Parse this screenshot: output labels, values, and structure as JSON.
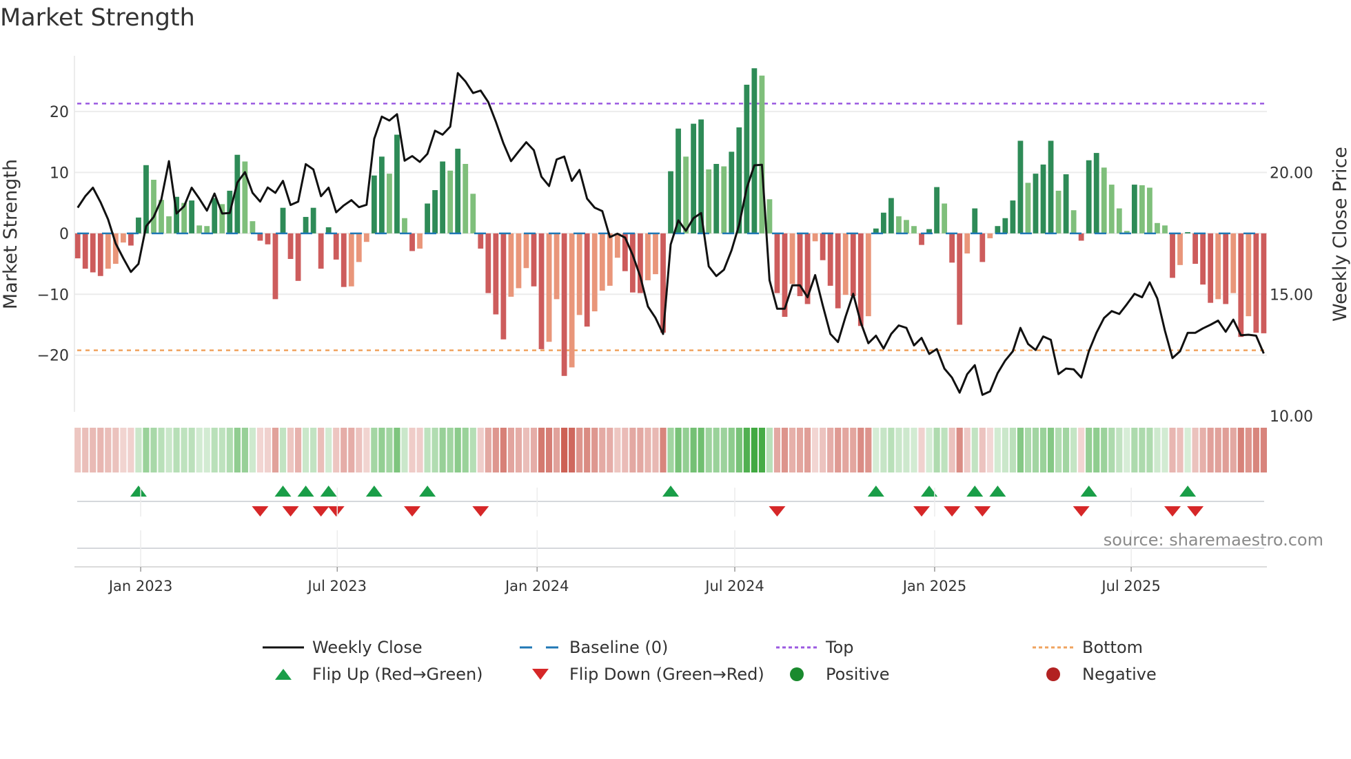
{
  "title": "Market Strength",
  "source": "source: sharemaestro.com",
  "legend": {
    "weekly_close": "Weekly Close",
    "baseline": "Baseline (0)",
    "top": "Top",
    "bottom": "Bottom",
    "flip_up": "Flip Up (Red→Green)",
    "flip_down": "Flip Down (Green→Red)",
    "positive": "Positive",
    "negative": "Negative"
  },
  "colors": {
    "pos_strong": "#2e8b57",
    "pos_weak": "#7fbf7b",
    "neg_strong": "#cd5c5c",
    "neg_weak": "#e9967a",
    "baseline": "#1f77b4",
    "top": "#9b59e0",
    "bottom": "#f0a35e",
    "price": "#111111",
    "flip_up": "#1a9e48",
    "flip_down": "#d62728",
    "positive": "#1a8a2e",
    "negative": "#b22222"
  },
  "chart_data": {
    "type": "bar",
    "title": "Market Strength",
    "ylabel": "Market Strength",
    "ylabel_right": "Weekly Close Price",
    "xlabel": "",
    "start_date": "2022-11-04",
    "frequency": "weekly",
    "ylim": [
      -29.3,
      29.15
    ],
    "ylim_right": [
      10.17,
      24.8
    ],
    "yticks_left": {
      "values": [
        -20,
        -10,
        0,
        10,
        20
      ],
      "labels": [
        "−20",
        "−10",
        "0",
        "10",
        "20"
      ]
    },
    "yticks_right": {
      "values": [
        10,
        15,
        20
      ],
      "labels": [
        "10.00",
        "15.00",
        "20.00"
      ]
    },
    "xticks": {
      "dates": [
        "2023-01-01",
        "2023-07-01",
        "2024-01-01",
        "2024-07-01",
        "2025-01-01",
        "2025-07-01"
      ],
      "labels": [
        "Jan 2023",
        "Jul 2023",
        "Jan 2024",
        "Jul 2024",
        "Jan 2025",
        "Jul 2025"
      ]
    },
    "top_level": 21.3,
    "bottom_level": -19.2,
    "baseline": 0,
    "strength": [
      -4.1,
      -5.8,
      -6.4,
      -7,
      -5.8,
      -5,
      -1.5,
      -2,
      2.6,
      11.2,
      8.8,
      5.5,
      2.8,
      6,
      5,
      5.4,
      1.3,
      1.2,
      5.8,
      4.8,
      7,
      12.9,
      11.8,
      2,
      -1.2,
      -1.8,
      -10.8,
      4.2,
      -4.2,
      -7.8,
      2.7,
      4.2,
      -5.8,
      1,
      -4.3,
      -8.8,
      -8.7,
      -4.7,
      -1.4,
      9.5,
      12.6,
      9.8,
      16.2,
      2.5,
      -2.9,
      -2.5,
      4.9,
      7.1,
      11.8,
      10.3,
      13.9,
      11.4,
      6.5,
      -2.5,
      -9.8,
      -13.3,
      -17.4,
      -10.4,
      -9,
      -5.7,
      -8.7,
      -19,
      -17.8,
      -10.8,
      -23.4,
      -22,
      -13.4,
      -15.3,
      -12.8,
      -9.4,
      -8.6,
      -4,
      -6.2,
      -9.7,
      -9.8,
      -7.7,
      -6.7,
      -16.3,
      10.2,
      17.2,
      12.6,
      18,
      18.7,
      10.5,
      11.4,
      11,
      13.4,
      17.4,
      24.4,
      27.1,
      25.9,
      5.6,
      -9.8,
      -13.7,
      -8.3,
      -10.3,
      -11.6,
      -1.3,
      -4.4,
      -8.6,
      -12.3,
      -10.1,
      -10.3,
      -15.2,
      -13.6,
      0.8,
      3.4,
      5.8,
      2.8,
      2.2,
      1.2,
      -1.9,
      0.7,
      7.6,
      4.9,
      -4.8,
      -15,
      -3.3,
      4.1,
      -4.7,
      -0.8,
      1.2,
      2.5,
      5.4,
      15.2,
      8.3,
      9.8,
      11.3,
      15.2,
      7,
      9.7,
      3.8,
      -1.2,
      12,
      13.2,
      10.8,
      8,
      4.1,
      0.4,
      8,
      7.9,
      7.5,
      1.7,
      1.3,
      -7.3,
      -5.2,
      0.2,
      -5,
      -8.4,
      -11.4,
      -10.8,
      -11.6,
      -9.8,
      -17,
      -13.6,
      -16.3,
      -16.4
    ],
    "weekly_close": [
      18.56,
      19.03,
      19.38,
      18.79,
      18.08,
      17.09,
      16.48,
      15.92,
      16.25,
      17.8,
      18.18,
      18.89,
      20.47,
      18.32,
      18.62,
      19.38,
      18.93,
      18.44,
      19.14,
      18.32,
      18.34,
      19.59,
      20.02,
      19.17,
      18.81,
      19.39,
      19.17,
      19.66,
      18.67,
      18.81,
      20.35,
      20.13,
      19.03,
      19.38,
      18.37,
      18.65,
      18.87,
      18.58,
      18.68,
      21.39,
      22.3,
      22.14,
      22.4,
      20.49,
      20.68,
      20.44,
      20.77,
      21.72,
      21.56,
      21.89,
      24.09,
      23.75,
      23.27,
      23.37,
      22.9,
      22.09,
      21.2,
      20.47,
      20.87,
      21.25,
      20.92,
      19.83,
      19.45,
      20.54,
      20.66,
      19.66,
      20.11,
      18.93,
      18.56,
      18.42,
      17.35,
      17.49,
      17.33,
      16.62,
      15.73,
      14.5,
      14.03,
      13.37,
      17.05,
      18.04,
      17.61,
      18.13,
      18.34,
      16.15,
      15.75,
      16.01,
      16.81,
      17.85,
      19.36,
      20.3,
      20.32,
      15.58,
      14.41,
      14.41,
      15.37,
      15.37,
      14.88,
      15.79,
      14.55,
      13.37,
      13.04,
      14.08,
      15.02,
      13.84,
      12.99,
      13.3,
      12.77,
      13.37,
      13.72,
      13.62,
      12.9,
      13.21,
      12.55,
      12.75,
      11.95,
      11.58,
      10.96,
      11.72,
      12.09,
      10.87,
      11.01,
      11.76,
      12.28,
      12.66,
      13.62,
      12.96,
      12.71,
      13.27,
      13.13,
      11.72,
      11.95,
      11.92,
      11.58,
      12.66,
      13.42,
      14.03,
      14.31,
      14.19,
      14.59,
      15.02,
      14.88,
      15.49,
      14.83,
      13.51,
      12.38,
      12.66,
      13.42,
      13.42,
      13.6,
      13.75,
      13.92,
      13.46,
      13.96,
      13.32,
      13.34,
      13.3,
      12.57
    ],
    "flip_up_weeks": [
      9,
      28,
      31,
      34,
      40,
      47,
      79,
      106,
      113,
      119,
      122,
      134,
      147
    ],
    "flip_down_weeks": [
      25,
      29,
      33,
      35,
      45,
      54,
      93,
      112,
      116,
      120,
      133,
      145,
      148
    ]
  }
}
